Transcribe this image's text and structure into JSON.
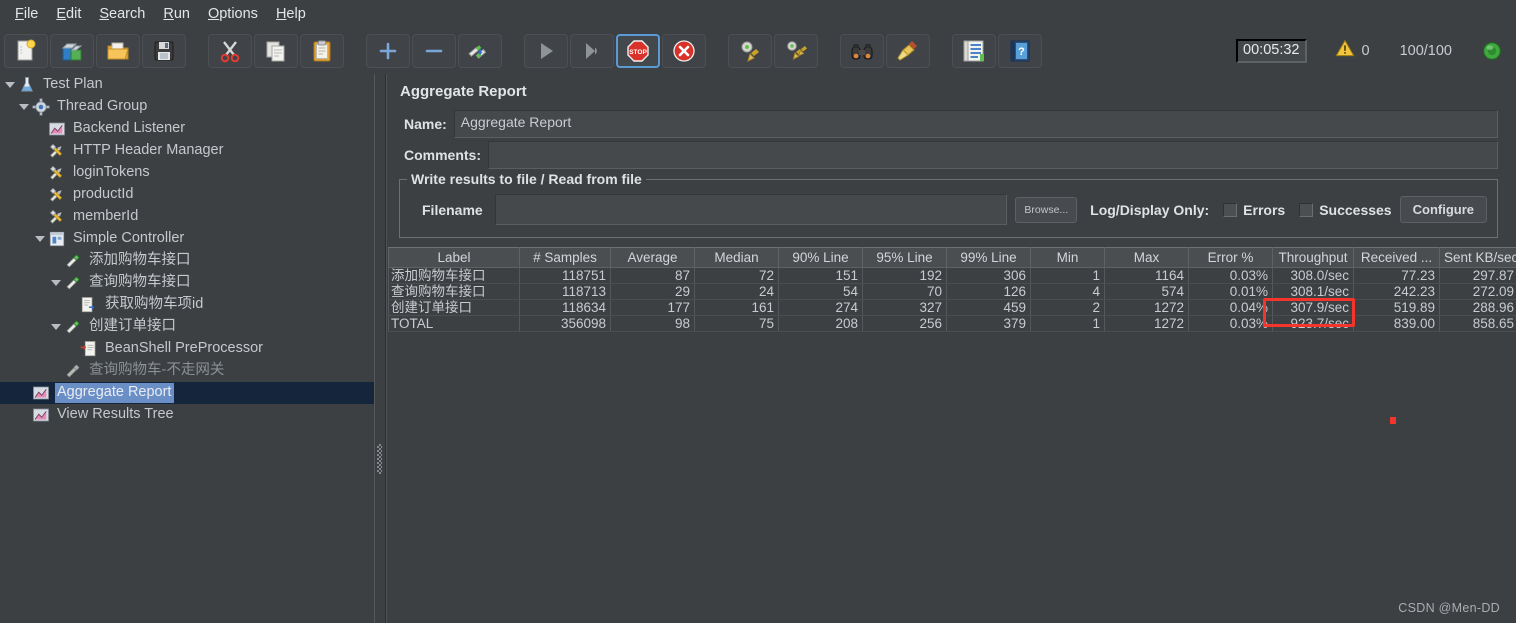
{
  "menu": {
    "items": [
      {
        "label": "File",
        "mnemonic": "F"
      },
      {
        "label": "Edit",
        "mnemonic": "E"
      },
      {
        "label": "Search",
        "mnemonic": "S"
      },
      {
        "label": "Run",
        "mnemonic": "R"
      },
      {
        "label": "Options",
        "mnemonic": "O"
      },
      {
        "label": "Help",
        "mnemonic": "H"
      }
    ]
  },
  "toolbar": {
    "buttons": [
      {
        "icon": "new-document-icon",
        "name": "new-button"
      },
      {
        "icon": "open-templates-icon",
        "name": "templates-button"
      },
      {
        "icon": "open-folder-icon",
        "name": "open-button"
      },
      {
        "icon": "save-floppy-icon",
        "name": "save-button"
      },
      {
        "icon": "cut-scissors-icon",
        "name": "cut-button"
      },
      {
        "icon": "copy-pages-icon",
        "name": "copy-button"
      },
      {
        "icon": "paste-clipboard-icon",
        "name": "paste-button"
      },
      {
        "icon": "plus-icon",
        "name": "expand-button"
      },
      {
        "icon": "minus-icon",
        "name": "collapse-button"
      },
      {
        "icon": "toggle-enable-icon",
        "name": "toggle-button"
      },
      {
        "icon": "play-icon",
        "name": "start-button"
      },
      {
        "icon": "play-no-timers-icon",
        "name": "start-no-pauses-button"
      },
      {
        "icon": "stop-sign-icon",
        "name": "stop-button",
        "focused": true
      },
      {
        "icon": "shutdown-icon",
        "name": "shutdown-button"
      },
      {
        "icon": "clear-gear-broom-icon",
        "name": "clear-button"
      },
      {
        "icon": "clear-all-broom-icon",
        "name": "clear-all-button"
      },
      {
        "icon": "binoculars-search-icon",
        "name": "search-button"
      },
      {
        "icon": "broom-reset-icon",
        "name": "reset-search-button"
      },
      {
        "icon": "function-helper-icon",
        "name": "function-helper-button"
      },
      {
        "icon": "help-book-icon",
        "name": "help-button"
      }
    ],
    "timer": "00:05:32",
    "warning_icon": "warning-triangle-icon",
    "warning_count": "0",
    "thread_counter": "100/100",
    "run_indicator": "green-run-indicator"
  },
  "tree": {
    "nodes": [
      {
        "label": "Test Plan",
        "depth": 0,
        "icon": "test-plan-icon",
        "toggle": "open"
      },
      {
        "label": "Thread Group",
        "depth": 1,
        "icon": "thread-group-icon",
        "toggle": "open"
      },
      {
        "label": "Backend Listener",
        "depth": 2,
        "icon": "listener-chart-icon",
        "toggle": "none"
      },
      {
        "label": "HTTP Header Manager",
        "depth": 2,
        "icon": "config-tools-icon",
        "toggle": "none"
      },
      {
        "label": "loginTokens",
        "depth": 2,
        "icon": "config-tools-icon",
        "toggle": "none"
      },
      {
        "label": "productId",
        "depth": 2,
        "icon": "config-tools-icon",
        "toggle": "none"
      },
      {
        "label": "memberId",
        "depth": 2,
        "icon": "config-tools-icon",
        "toggle": "none"
      },
      {
        "label": "Simple Controller",
        "depth": 1,
        "icon": "controller-icon",
        "toggle": "open"
      },
      {
        "label": "添加购物车接口",
        "depth": 2,
        "icon": "sampler-icon",
        "toggle": "none"
      },
      {
        "label": "查询购物车接口",
        "depth": 2,
        "icon": "sampler-icon",
        "toggle": "open"
      },
      {
        "label": "获取购物车项id",
        "depth": 3,
        "icon": "postprocessor-icon",
        "toggle": "none"
      },
      {
        "label": "创建订单接口",
        "depth": 2,
        "icon": "sampler-icon",
        "toggle": "open"
      },
      {
        "label": "BeanShell PreProcessor",
        "depth": 3,
        "icon": "preprocessor-icon",
        "toggle": "none"
      },
      {
        "label": "查询购物车-不走网关",
        "depth": 2,
        "icon": "sampler-disabled-icon",
        "toggle": "none",
        "disabled": true
      },
      {
        "label": "Aggregate Report",
        "depth": 1,
        "icon": "listener-chart-icon",
        "toggle": "none",
        "selected": true
      },
      {
        "label": "View Results Tree",
        "depth": 1,
        "icon": "listener-chart-icon",
        "toggle": "none"
      }
    ]
  },
  "panel": {
    "title": "Aggregate Report",
    "name_label": "Name:",
    "name_value": "Aggregate Report",
    "comments_label": "Comments:",
    "comments_value": "",
    "group_legend": "Write results to file / Read from file",
    "filename_label": "Filename",
    "filename_value": "",
    "browse_button": "Browse...",
    "log_display_label": "Log/Display Only:",
    "errors_label": "Errors",
    "successes_label": "Successes",
    "configure_button": "Configure"
  },
  "table": {
    "columns": [
      "Label",
      "# Samples",
      "Average",
      "Median",
      "90% Line",
      "95% Line",
      "99% Line",
      "Min",
      "Max",
      "Error %",
      "Throughput",
      "Received ...",
      "Sent KB/sec"
    ],
    "rows": [
      [
        "添加购物车接口",
        "118751",
        "87",
        "72",
        "151",
        "192",
        "306",
        "1",
        "1164",
        "0.03%",
        "308.0/sec",
        "77.23",
        "297.87"
      ],
      [
        "查询购物车接口",
        "118713",
        "29",
        "24",
        "54",
        "70",
        "126",
        "4",
        "574",
        "0.01%",
        "308.1/sec",
        "242.23",
        "272.09"
      ],
      [
        "创建订单接口",
        "118634",
        "177",
        "161",
        "274",
        "327",
        "459",
        "2",
        "1272",
        "0.04%",
        "307.9/sec",
        "519.89",
        "288.96"
      ],
      [
        "TOTAL",
        "356098",
        "98",
        "75",
        "208",
        "256",
        "379",
        "1",
        "1272",
        "0.03%",
        "923.7/sec",
        "839.00",
        "858.65"
      ]
    ]
  },
  "annotations": {
    "highlight_value": "307.9/sec",
    "watermark": "CSDN @Men-DD"
  },
  "colors": {
    "background": "#3c4043",
    "accent_red": "#f5352b",
    "selection_blue": "#6a8ec6",
    "focus_blue": "#5b9bd5"
  }
}
